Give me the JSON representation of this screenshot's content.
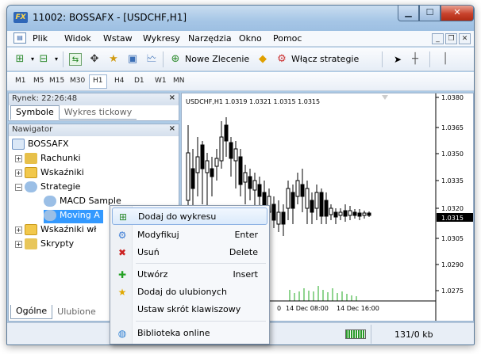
{
  "window": {
    "title": "11002: BOSSAFX - [USDCHF,H1]",
    "app_badge": "FX"
  },
  "menu": [
    "Plik",
    "Widok",
    "Wstaw",
    "Wykresy",
    "Narzędzia",
    "Okno",
    "Pomoc"
  ],
  "toolbar": {
    "new_order": "Nowe Zlecenie",
    "enable_strategies": "Włącz strategie"
  },
  "timeframes": [
    "M1",
    "M5",
    "M15",
    "M30",
    "H1",
    "H4",
    "D1",
    "W1",
    "MN"
  ],
  "active_timeframe": "H1",
  "market_watch": {
    "title": "Rynek: 22:26:48",
    "tabs": [
      "Symbole",
      "Wykres tickowy"
    ]
  },
  "navigator": {
    "title": "Nawigator",
    "items": [
      {
        "label": "BOSSAFX"
      },
      {
        "label": "Rachunki"
      },
      {
        "label": "Wskaźniki"
      },
      {
        "label": "Strategie"
      },
      {
        "label": "MACD Sample"
      },
      {
        "label": "Moving A"
      },
      {
        "label": "Wskaźniki wł"
      },
      {
        "label": "Skrypty"
      }
    ],
    "tabs": [
      "Ogólne",
      "Ulubione"
    ]
  },
  "chart": {
    "header": "USDCHF,H1  1.0319 1.0321 1.0315 1.0315",
    "price_labels": [
      "1.0380",
      "1.0365",
      "1.0350",
      "1.0335",
      "1.0320",
      "1.0305",
      "1.0290",
      "1.0275"
    ],
    "current_price": "1.0315",
    "time_labels": [
      "0",
      "14 Dec 08:00",
      "14 Dec 16:00"
    ]
  },
  "status": {
    "traffic": "131/0 kb"
  },
  "context_menu": [
    {
      "label": "Dodaj do wykresu",
      "shortcut": "",
      "icon": "add-to-chart-icon"
    },
    {
      "label": "Modyfikuj",
      "shortcut": "Enter",
      "icon": "gear-icon"
    },
    {
      "label": "Usuń",
      "shortcut": "Delete",
      "icon": "delete-icon"
    },
    {
      "label": "Utwórz",
      "shortcut": "Insert",
      "icon": "plus-icon"
    },
    {
      "label": "Dodaj do ulubionych",
      "shortcut": "",
      "icon": "favorite-icon"
    },
    {
      "label": "Ustaw skrót klawiszowy",
      "shortcut": "",
      "icon": ""
    },
    {
      "label": "Biblioteka online",
      "shortcut": "",
      "icon": "globe-icon"
    }
  ],
  "colors": {
    "highlight": "#3399ff",
    "chart_axis": "#000000",
    "volume": "#22aa22"
  }
}
